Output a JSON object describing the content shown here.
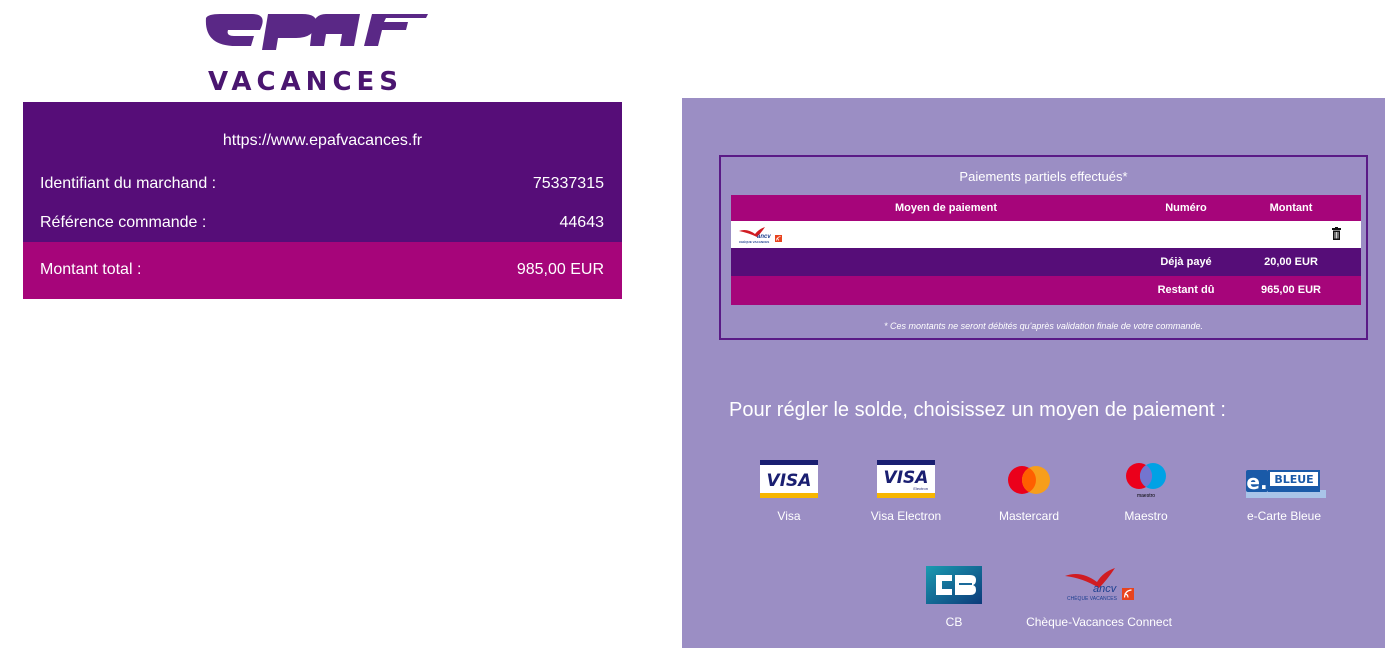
{
  "logo": {
    "wordmark": "VACANCES"
  },
  "merchant": {
    "url": "https://www.epafvacances.fr",
    "merchant_id_label": "Identifiant du marchand :",
    "merchant_id_value": "75337315",
    "order_ref_label": "Référence commande :",
    "order_ref_value": "44643",
    "total_label": "Montant total :",
    "total_value": "985,00 EUR"
  },
  "partial_payments": {
    "title": "Paiements partiels effectués*",
    "headers": {
      "method": "Moyen de paiement",
      "number": "Numéro",
      "amount": "Montant"
    },
    "row": {
      "method_icon": "ancv-cheque-vacances-icon",
      "number": "",
      "amount": ""
    },
    "paid_label": "Déjà payé",
    "paid_value": "20,00 EUR",
    "due_label": "Restant dû",
    "due_value": "965,00 EUR",
    "note": "* Ces montants ne seront débités qu'après validation finale de votre commande."
  },
  "choose_title": "Pour régler le solde, choisissez un moyen de paiement :",
  "methods": [
    {
      "name": "Visa",
      "icon": "visa-icon"
    },
    {
      "name": "Visa Electron",
      "icon": "visa-electron-icon"
    },
    {
      "name": "Mastercard",
      "icon": "mastercard-icon"
    },
    {
      "name": "Maestro",
      "icon": "maestro-icon"
    },
    {
      "name": "e-Carte Bleue",
      "icon": "e-carte-bleue-icon"
    },
    {
      "name": "CB",
      "icon": "cb-icon"
    },
    {
      "name": "Chèque-Vacances Connect",
      "icon": "ancv-cheque-vacances-icon"
    }
  ],
  "colors": {
    "purple": "#560d78",
    "magenta": "#a6057a",
    "lavender": "#9b8ec4"
  }
}
